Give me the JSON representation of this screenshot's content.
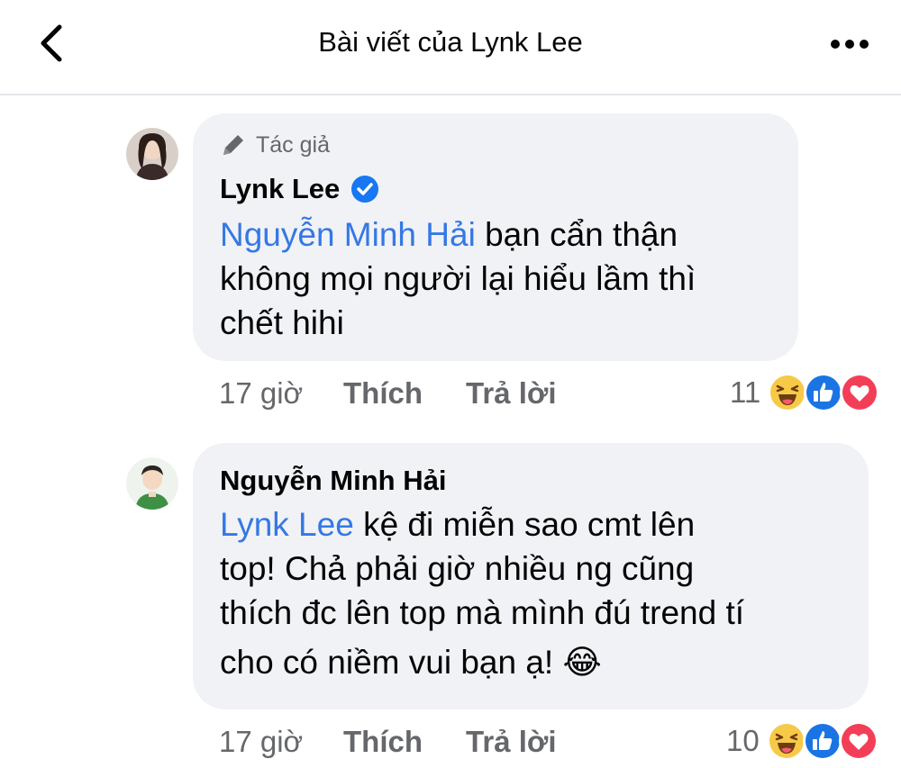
{
  "header": {
    "title": "Bài viết của Lynk Lee"
  },
  "comments": [
    {
      "author_badge": "Tác giả",
      "author": "Lynk Lee",
      "verified": true,
      "mention": "Nguyễn Minh Hải",
      "lines": [
        " bạn cẩn thận",
        "không mọi người lại hiểu lầm thì",
        "chết hihi"
      ],
      "time": "17 giờ",
      "like_label": "Thích",
      "reply_label": "Trả lời",
      "reaction_count": "11",
      "reactions": [
        "haha-icon",
        "like-icon",
        "love-icon"
      ]
    },
    {
      "author": "Nguyễn Minh Hải",
      "mention": "Lynk Lee",
      "lines": [
        " kệ đi miễn sao cmt lên",
        "top! Chả phải giờ nhiều ng cũng",
        "thích đc lên top mà mình đú trend tí",
        "cho có niềm vui bạn ạ! 😂"
      ],
      "time": "17 giờ",
      "like_label": "Thích",
      "reply_label": "Trả lời",
      "reaction_count": "10",
      "reactions": [
        "haha-icon",
        "like-icon",
        "love-icon"
      ]
    }
  ],
  "colors": {
    "mention": "#3578e5",
    "bubble": "#f0f2f5",
    "meta": "#65676b",
    "verified": "#1877f2"
  }
}
